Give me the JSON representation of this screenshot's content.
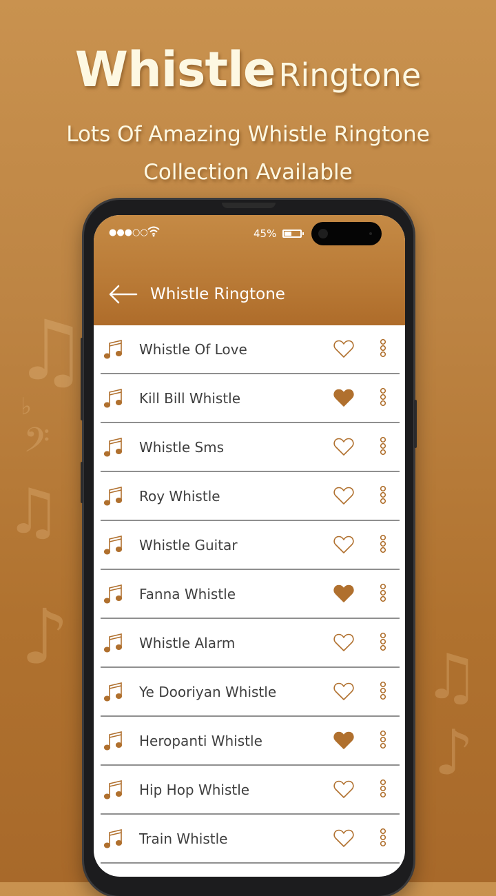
{
  "promo": {
    "title_bold": "Whistle",
    "title_light": "Ringtone",
    "subtitle_line1": "Lots Of Amazing Whistle Ringtone",
    "subtitle_line2": "Collection Available"
  },
  "status_bar": {
    "signal": "●●●○○",
    "battery_percent": "45%",
    "battery_level": 0.45
  },
  "app_bar": {
    "back_icon": "arrow-left-icon",
    "title": "Whistle Ringtone"
  },
  "colors": {
    "accent": "#b0702e",
    "text": "#3f3f3f",
    "divider": "#8f8f8f"
  },
  "ringtones": [
    {
      "name": "Whistle Of Love",
      "favorite": false
    },
    {
      "name": "Kill Bill Whistle",
      "favorite": true
    },
    {
      "name": "Whistle Sms",
      "favorite": false
    },
    {
      "name": "Roy Whistle",
      "favorite": false
    },
    {
      "name": "Whistle Guitar",
      "favorite": false
    },
    {
      "name": "Fanna Whistle",
      "favorite": true
    },
    {
      "name": "Whistle Alarm",
      "favorite": false
    },
    {
      "name": "Ye Dooriyan Whistle",
      "favorite": false
    },
    {
      "name": "Heropanti Whistle",
      "favorite": true
    },
    {
      "name": "Hip Hop Whistle",
      "favorite": false
    },
    {
      "name": "Train Whistle",
      "favorite": false
    }
  ]
}
